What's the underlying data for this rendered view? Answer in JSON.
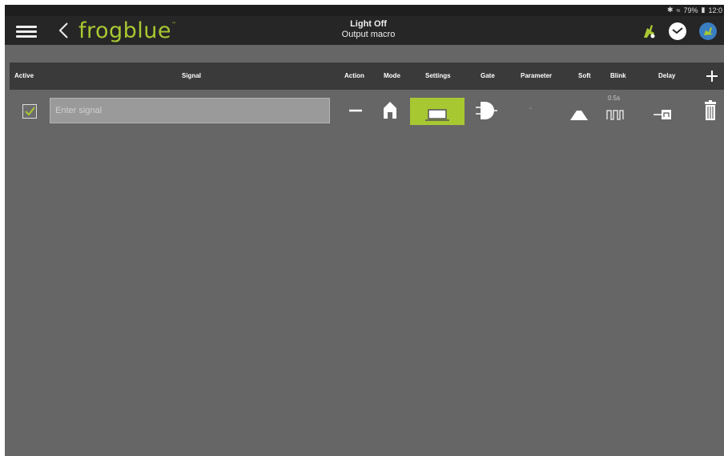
{
  "status_bar": {
    "bluetooth_icon": "bluetooth-icon",
    "wifi_icon": "wifi-icon",
    "battery": "79%",
    "battery_icon": "battery-icon",
    "time": "12:0"
  },
  "app_bar": {
    "menu_icon": "hamburger-menu-icon",
    "back_icon": "chevron-left-icon",
    "logo_text": "frogblue",
    "logo_mark": "™",
    "title": "Light Off",
    "subtitle": "Output macro",
    "actions": [
      "run-macro-icon",
      "clock-icon",
      "edit-icon"
    ]
  },
  "table": {
    "columns": {
      "active": "Active",
      "signal": "Signal",
      "action": "Action",
      "mode": "Mode",
      "settings": "Settings",
      "gate": "Gate",
      "parameter": "Parameter",
      "soft": "Soft",
      "blink": "Blink",
      "delay": "Delay"
    },
    "add_icon": "plus-icon",
    "rows": [
      {
        "active": true,
        "signal_placeholder": "Enter signal",
        "signal_value": "",
        "action": "minus",
        "mode": "home",
        "settings": "light-off",
        "gate": "and-gate",
        "parameter": "-",
        "soft": "ramp",
        "blink_value": "0.5s",
        "delay": "delay",
        "delete_icon": "trash-icon"
      }
    ]
  },
  "colors": {
    "accent": "#a8c832",
    "background": "#666666",
    "header": "#3a3a3a",
    "appbar": "#262626"
  }
}
